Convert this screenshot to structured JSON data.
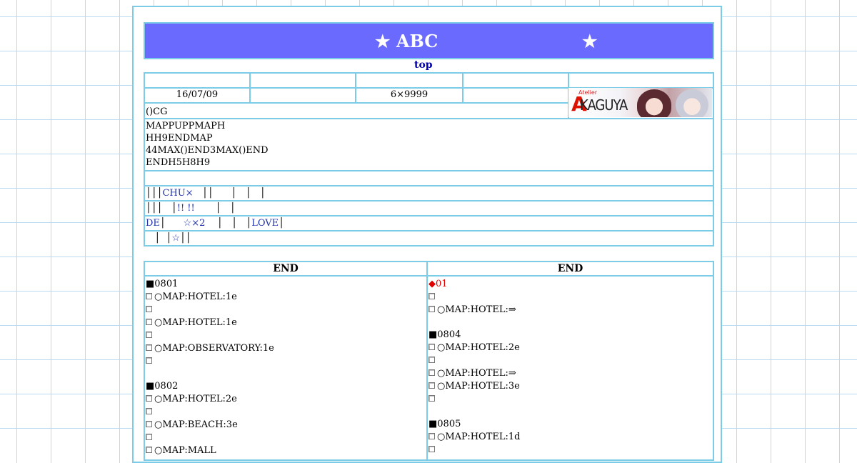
{
  "header": {
    "title_left": "★ ABC",
    "title_right": "★",
    "top_link": "top"
  },
  "info_row": {
    "date": "16/07/09",
    "size": "6×9999",
    "label": "()CG"
  },
  "banner": {
    "brand_small": "Atelier",
    "brand_initial": "A",
    "brand_name": "KAGUYA"
  },
  "description": [
    "MAPPUPPMAPH",
    "HH9ENDMAP",
    "44MAX()END3MAX()END",
    "ENDH5H8H9"
  ],
  "nav_rows": [
    [
      {
        "text": "│││",
        "link": false
      },
      {
        "text": "CHU×",
        "link": true
      },
      {
        "text": "   ││      │   │   │",
        "link": false
      }
    ],
    [
      {
        "text": "│││   │",
        "link": false
      },
      {
        "text": "!! !!",
        "link": true
      },
      {
        "text": "       │   │",
        "link": false
      }
    ],
    [
      {
        "text": "DE",
        "link": true
      },
      {
        "text": "│      ",
        "link": false
      },
      {
        "text": "☆×2",
        "link": true
      },
      {
        "text": "    │   │   │",
        "link": false
      },
      {
        "text": "LOVE",
        "link": true
      },
      {
        "text": "│",
        "link": false
      }
    ],
    [
      {
        "text": "   │  │",
        "link": false
      },
      {
        "text": "☆",
        "link": true
      },
      {
        "text": "││",
        "link": false
      }
    ]
  ],
  "columns": {
    "left_header": "END",
    "right_header": "END",
    "left": [
      {
        "type": "heading",
        "text": "■0801"
      },
      {
        "type": "item",
        "text": "○MAP:HOTEL:1e"
      },
      {
        "type": "item",
        "text": ""
      },
      {
        "type": "item",
        "text": "○MAP:HOTEL:1e"
      },
      {
        "type": "item",
        "text": ""
      },
      {
        "type": "item",
        "text": "○MAP:OBSERVATORY:1e"
      },
      {
        "type": "item",
        "text": ""
      },
      {
        "type": "gap"
      },
      {
        "type": "heading",
        "text": "■0802"
      },
      {
        "type": "item",
        "text": "○MAP:HOTEL:2e"
      },
      {
        "type": "item",
        "text": ""
      },
      {
        "type": "item",
        "text": "○MAP:BEACH:3e"
      },
      {
        "type": "item",
        "text": ""
      },
      {
        "type": "item",
        "text": "○MAP:MALL"
      }
    ],
    "right": [
      {
        "type": "heading-red",
        "text": "◆01"
      },
      {
        "type": "item",
        "text": ""
      },
      {
        "type": "item",
        "text": "○MAP:HOTEL:⇒"
      },
      {
        "type": "gap"
      },
      {
        "type": "heading",
        "text": "■0804"
      },
      {
        "type": "item",
        "text": "○MAP:HOTEL:2e"
      },
      {
        "type": "item",
        "text": ""
      },
      {
        "type": "item",
        "text": "○MAP:HOTEL:⇒"
      },
      {
        "type": "item",
        "text": "○MAP:HOTEL:3e"
      },
      {
        "type": "item",
        "text": ""
      },
      {
        "type": "gap"
      },
      {
        "type": "heading",
        "text": "■0805"
      },
      {
        "type": "item",
        "text": "○MAP:HOTEL:1d"
      },
      {
        "type": "item",
        "text": ""
      }
    ]
  }
}
